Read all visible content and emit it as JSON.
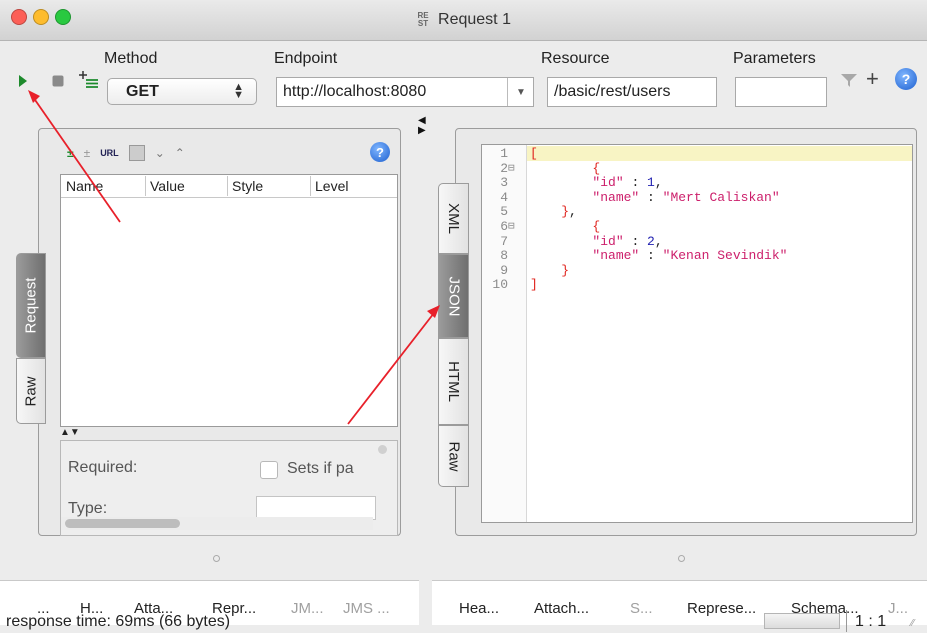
{
  "window": {
    "title": "Request 1",
    "app_icon": "rest-app-icon"
  },
  "toolbar": {
    "method_label": "Method",
    "method_value": "GET",
    "endpoint_label": "Endpoint",
    "endpoint_value": "http://localhost:8080",
    "resource_label": "Resource",
    "resource_value": "/basic/rest/users",
    "parameters_label": "Parameters",
    "parameters_value": ""
  },
  "request_panel": {
    "columns": [
      "Name",
      "Value",
      "Style",
      "Level"
    ],
    "required_label": "Required:",
    "sets_if_label": "Sets if pa",
    "type_label": "Type:",
    "tabs": {
      "request": "Request",
      "raw": "Raw"
    }
  },
  "response_panel": {
    "tabs": {
      "xml": "XML",
      "json": "JSON",
      "html": "HTML",
      "raw": "Raw"
    },
    "lines": [
      {
        "n": "1",
        "text": "["
      },
      {
        "n": "2",
        "text": "        {"
      },
      {
        "n": "3",
        "text": "        \"id\" : 1,"
      },
      {
        "n": "4",
        "text": "        \"name\" : \"Mert Caliskan\""
      },
      {
        "n": "5",
        "text": "    },"
      },
      {
        "n": "6",
        "text": "        {"
      },
      {
        "n": "7",
        "text": "        \"id\" : 2,"
      },
      {
        "n": "8",
        "text": "        \"name\" : \"Kenan Sevindik\""
      },
      {
        "n": "9",
        "text": "    }"
      },
      {
        "n": "10",
        "text": "]"
      }
    ]
  },
  "bottom_tabs_left": [
    "...",
    "H...",
    "Atta...",
    "Repr...",
    "JM...",
    "JMS ..."
  ],
  "bottom_tabs_right": [
    "Hea...",
    "Attach...",
    "S...",
    "Represe...",
    "Schema...",
    "J..."
  ],
  "status": {
    "text": "response time: 69ms (66 bytes)",
    "position": "1 : 1"
  },
  "colors": {
    "accent_red": "#e8202a",
    "json_key": "#cc1f6b",
    "json_number": "#1f1fb0",
    "bracket": "#e0241e",
    "highlight": "#f8f4c4"
  }
}
